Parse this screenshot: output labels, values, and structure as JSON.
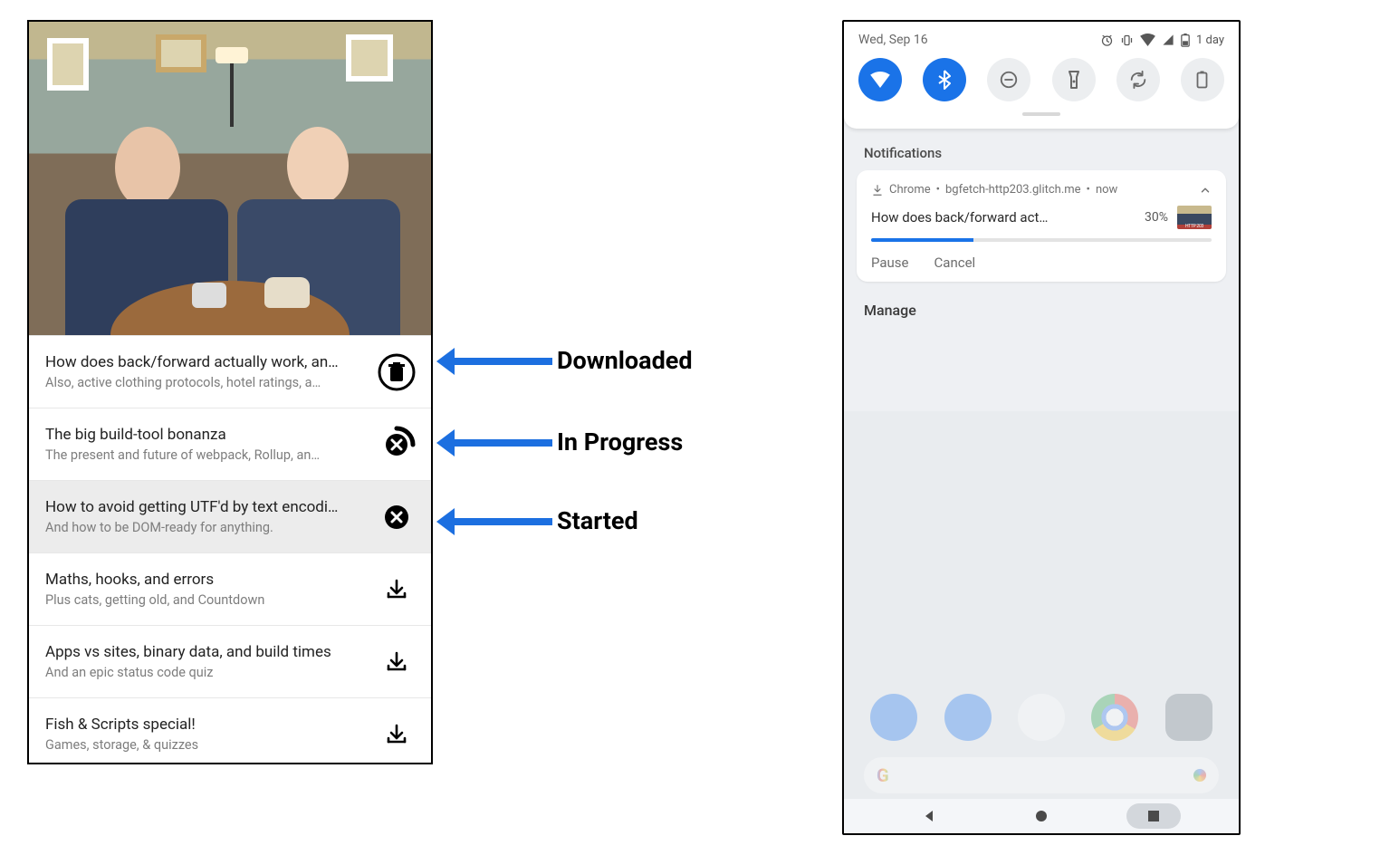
{
  "left": {
    "episodes": [
      {
        "title": "How does back/forward actually work, an…",
        "subtitle": "Also, active clothing protocols, hotel ratings, a…",
        "state": "downloaded",
        "selected": false
      },
      {
        "title": "The big build-tool bonanza",
        "subtitle": "The present and future of webpack, Rollup, an…",
        "state": "in_progress",
        "selected": false
      },
      {
        "title": "How to avoid getting UTF'd by text encodi…",
        "subtitle": "And how to be DOM-ready for anything.",
        "state": "started",
        "selected": true
      },
      {
        "title": "Maths, hooks, and errors",
        "subtitle": "Plus cats, getting old, and Countdown",
        "state": "not_downloaded",
        "selected": false
      },
      {
        "title": "Apps vs sites, binary data, and build times",
        "subtitle": "And an epic status code quiz",
        "state": "not_downloaded",
        "selected": false
      },
      {
        "title": "Fish & Scripts special!",
        "subtitle": "Games, storage, & quizzes",
        "state": "not_downloaded",
        "selected": false
      }
    ]
  },
  "annotations": {
    "downloaded": "Downloaded",
    "in_progress": "In Progress",
    "started": "Started"
  },
  "right": {
    "status_date": "Wed, Sep 16",
    "status_battery_label": "1 day",
    "toggles": [
      {
        "name": "wifi",
        "on": true
      },
      {
        "name": "bluetooth",
        "on": true
      },
      {
        "name": "dnd",
        "on": false
      },
      {
        "name": "flashlight",
        "on": false
      },
      {
        "name": "autorotate",
        "on": false
      },
      {
        "name": "battery-saver",
        "on": false
      }
    ],
    "notifications_label": "Notifications",
    "notification": {
      "app": "Chrome",
      "source": "bgfetch-http203.glitch.me",
      "time": "now",
      "title": "How does back/forward act…",
      "percent_text": "30%",
      "percent": 30,
      "actions": {
        "pause": "Pause",
        "cancel": "Cancel"
      }
    },
    "manage_label": "Manage"
  }
}
